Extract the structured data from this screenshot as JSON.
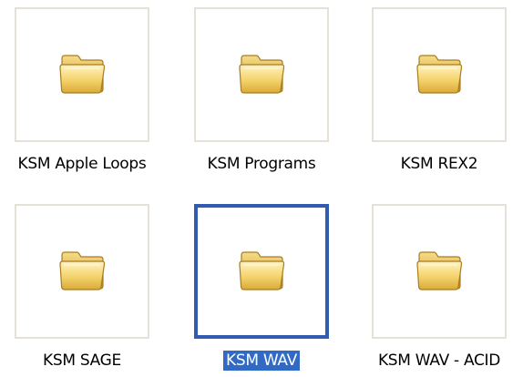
{
  "folders": [
    {
      "name": "KSM Apple Loops",
      "selected": false,
      "icon": "folder-icon"
    },
    {
      "name": "KSM Programs",
      "selected": false,
      "icon": "folder-icon"
    },
    {
      "name": "KSM REX2",
      "selected": false,
      "icon": "folder-icon"
    },
    {
      "name": "KSM SAGE",
      "selected": false,
      "icon": "folder-icon"
    },
    {
      "name": "KSM WAV",
      "selected": true,
      "icon": "folder-icon"
    },
    {
      "name": "KSM WAV - ACID",
      "selected": false,
      "icon": "folder-icon"
    }
  ],
  "colors": {
    "selection_border": "#2f5bb0",
    "selection_highlight": "#316ac5",
    "thumbnail_border": "#e6e1d6",
    "folder_yellow": "#f4d36b"
  }
}
